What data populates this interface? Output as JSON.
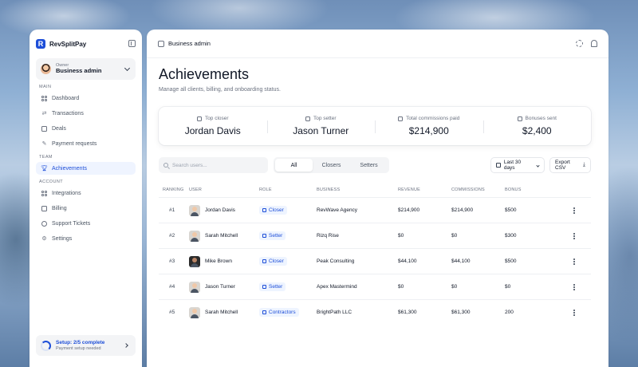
{
  "app": {
    "name": "RevSplitPay",
    "logo_letter": "R",
    "accent": "#1d4ed8"
  },
  "account": {
    "role": "Owner",
    "name": "Business admin"
  },
  "nav": {
    "main_label": "MAIN",
    "team_label": "TEAM",
    "account_label": "ACCOUNT",
    "main": [
      {
        "label": "Dashboard",
        "icon": "grid-icon"
      },
      {
        "label": "Transactions",
        "icon": "swap-icon"
      },
      {
        "label": "Deals",
        "icon": "briefcase-icon"
      },
      {
        "label": "Payment requests",
        "icon": "edit-icon"
      }
    ],
    "team": [
      {
        "label": "Achievements",
        "icon": "trophy-icon",
        "active": true
      }
    ],
    "account": [
      {
        "label": "Integrations",
        "icon": "integrations-icon"
      },
      {
        "label": "Billing",
        "icon": "card-icon"
      },
      {
        "label": "Support Tickets",
        "icon": "headset-icon"
      },
      {
        "label": "Settings",
        "icon": "gear-icon"
      }
    ]
  },
  "setup": {
    "title": "Setup: 2/5 complete",
    "subtitle": "Payment setup needed",
    "progress": 0.4
  },
  "topbar": {
    "title": "Business admin"
  },
  "page": {
    "title": "Achievements",
    "subtitle": "Manage all clients, billing, and onboarding status."
  },
  "stats": [
    {
      "label": "Top closer",
      "value": "Jordan Davis"
    },
    {
      "label": "Top setter",
      "value": "Jason Turner"
    },
    {
      "label": "Total commissions paid",
      "value": "$214,900"
    },
    {
      "label": "Bonuses sent",
      "value": "$2,400"
    }
  ],
  "toolbar": {
    "search_placeholder": "Search users...",
    "tabs": [
      "All",
      "Closers",
      "Setters"
    ],
    "active_tab": "All",
    "date_range": "Last 30 days",
    "export_label": "Export CSV"
  },
  "table": {
    "headers": [
      "RANKING",
      "USER",
      "ROLE",
      "BUSINESS",
      "REVENUE",
      "COMMISSIONS",
      "BONUS"
    ],
    "rows": [
      {
        "rank": "#1",
        "user": "Jordan Davis",
        "role": "Closer",
        "business": "RevWave Agency",
        "revenue": "$214,900",
        "commissions": "$214,900",
        "bonus": "$500"
      },
      {
        "rank": "#2",
        "user": "Sarah Mitchell",
        "role": "Setter",
        "business": "Rizq Rise",
        "revenue": "$0",
        "commissions": "$0",
        "bonus": "$300"
      },
      {
        "rank": "#3",
        "user": "Mike Brown",
        "role": "Closer",
        "business": "Peak Consulting",
        "revenue": "$44,100",
        "commissions": "$44,100",
        "bonus": "$500"
      },
      {
        "rank": "#4",
        "user": "Jason Turner",
        "role": "Setter",
        "business": "Apex Mastermind",
        "revenue": "$0",
        "commissions": "$0",
        "bonus": "$0"
      },
      {
        "rank": "#5",
        "user": "Sarah Mitchell",
        "role": "Contractors",
        "business": "BrightPath LLC",
        "revenue": "$61,300",
        "commissions": "$61,300",
        "bonus": "200"
      }
    ]
  }
}
